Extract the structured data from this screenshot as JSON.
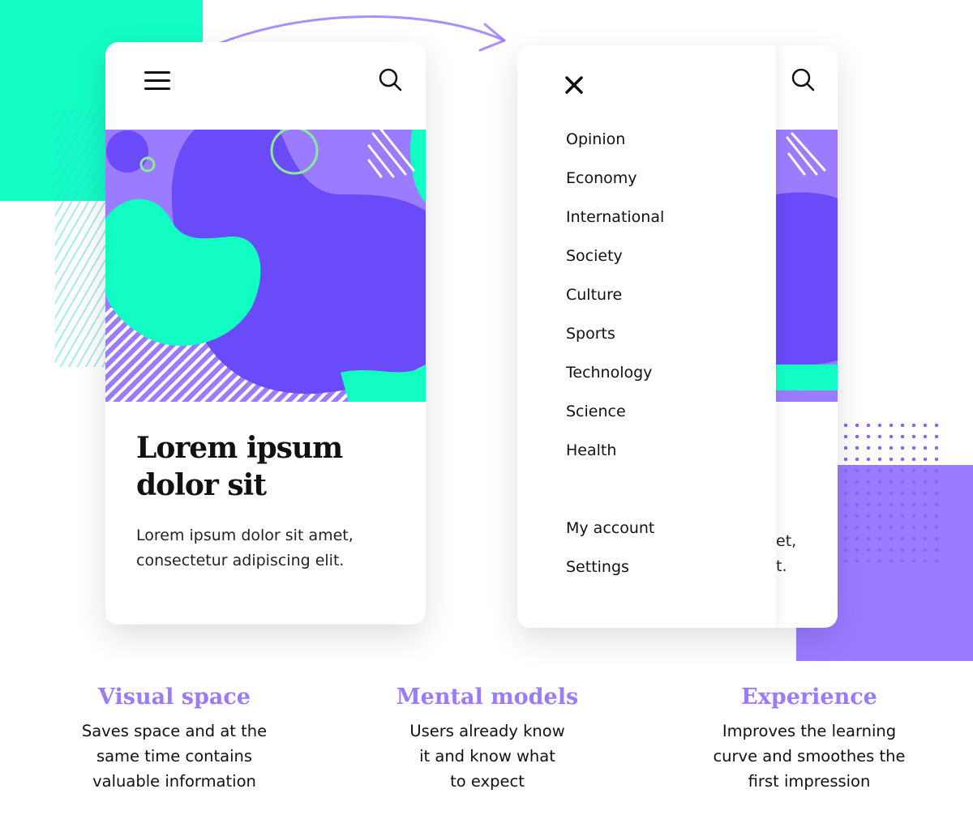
{
  "colors": {
    "accent_purple": "#9b7bff",
    "deep_purple": "#6a4af9",
    "mint": "#12fdc4"
  },
  "card_closed": {
    "menu_icon": "hamburger-icon",
    "search_icon": "search-icon",
    "headline_line1": "Lorem ipsum",
    "headline_line2": "dolor sit",
    "body_line1": "Lorem ipsum dolor sit amet,",
    "body_line2": "consectetur adipiscing elit."
  },
  "card_open": {
    "close_icon": "close-icon",
    "menu_items": [
      "Opinion",
      "Economy",
      "International",
      "Society",
      "Culture",
      "Sports",
      "Technology",
      "Science",
      "Health"
    ],
    "account_items": [
      "My account",
      "Settings"
    ],
    "peek_line1": "et,",
    "peek_line2": "t."
  },
  "benefits": [
    {
      "title": "Visual space",
      "lines": [
        "Saves space and at the",
        "same time contains",
        "valuable information"
      ]
    },
    {
      "title": "Mental models",
      "lines": [
        "Users already know",
        "it and know what",
        "to expect"
      ]
    },
    {
      "title": "Experience",
      "lines": [
        "Improves the learning",
        "curve and smoothes the",
        "first impression"
      ]
    }
  ]
}
